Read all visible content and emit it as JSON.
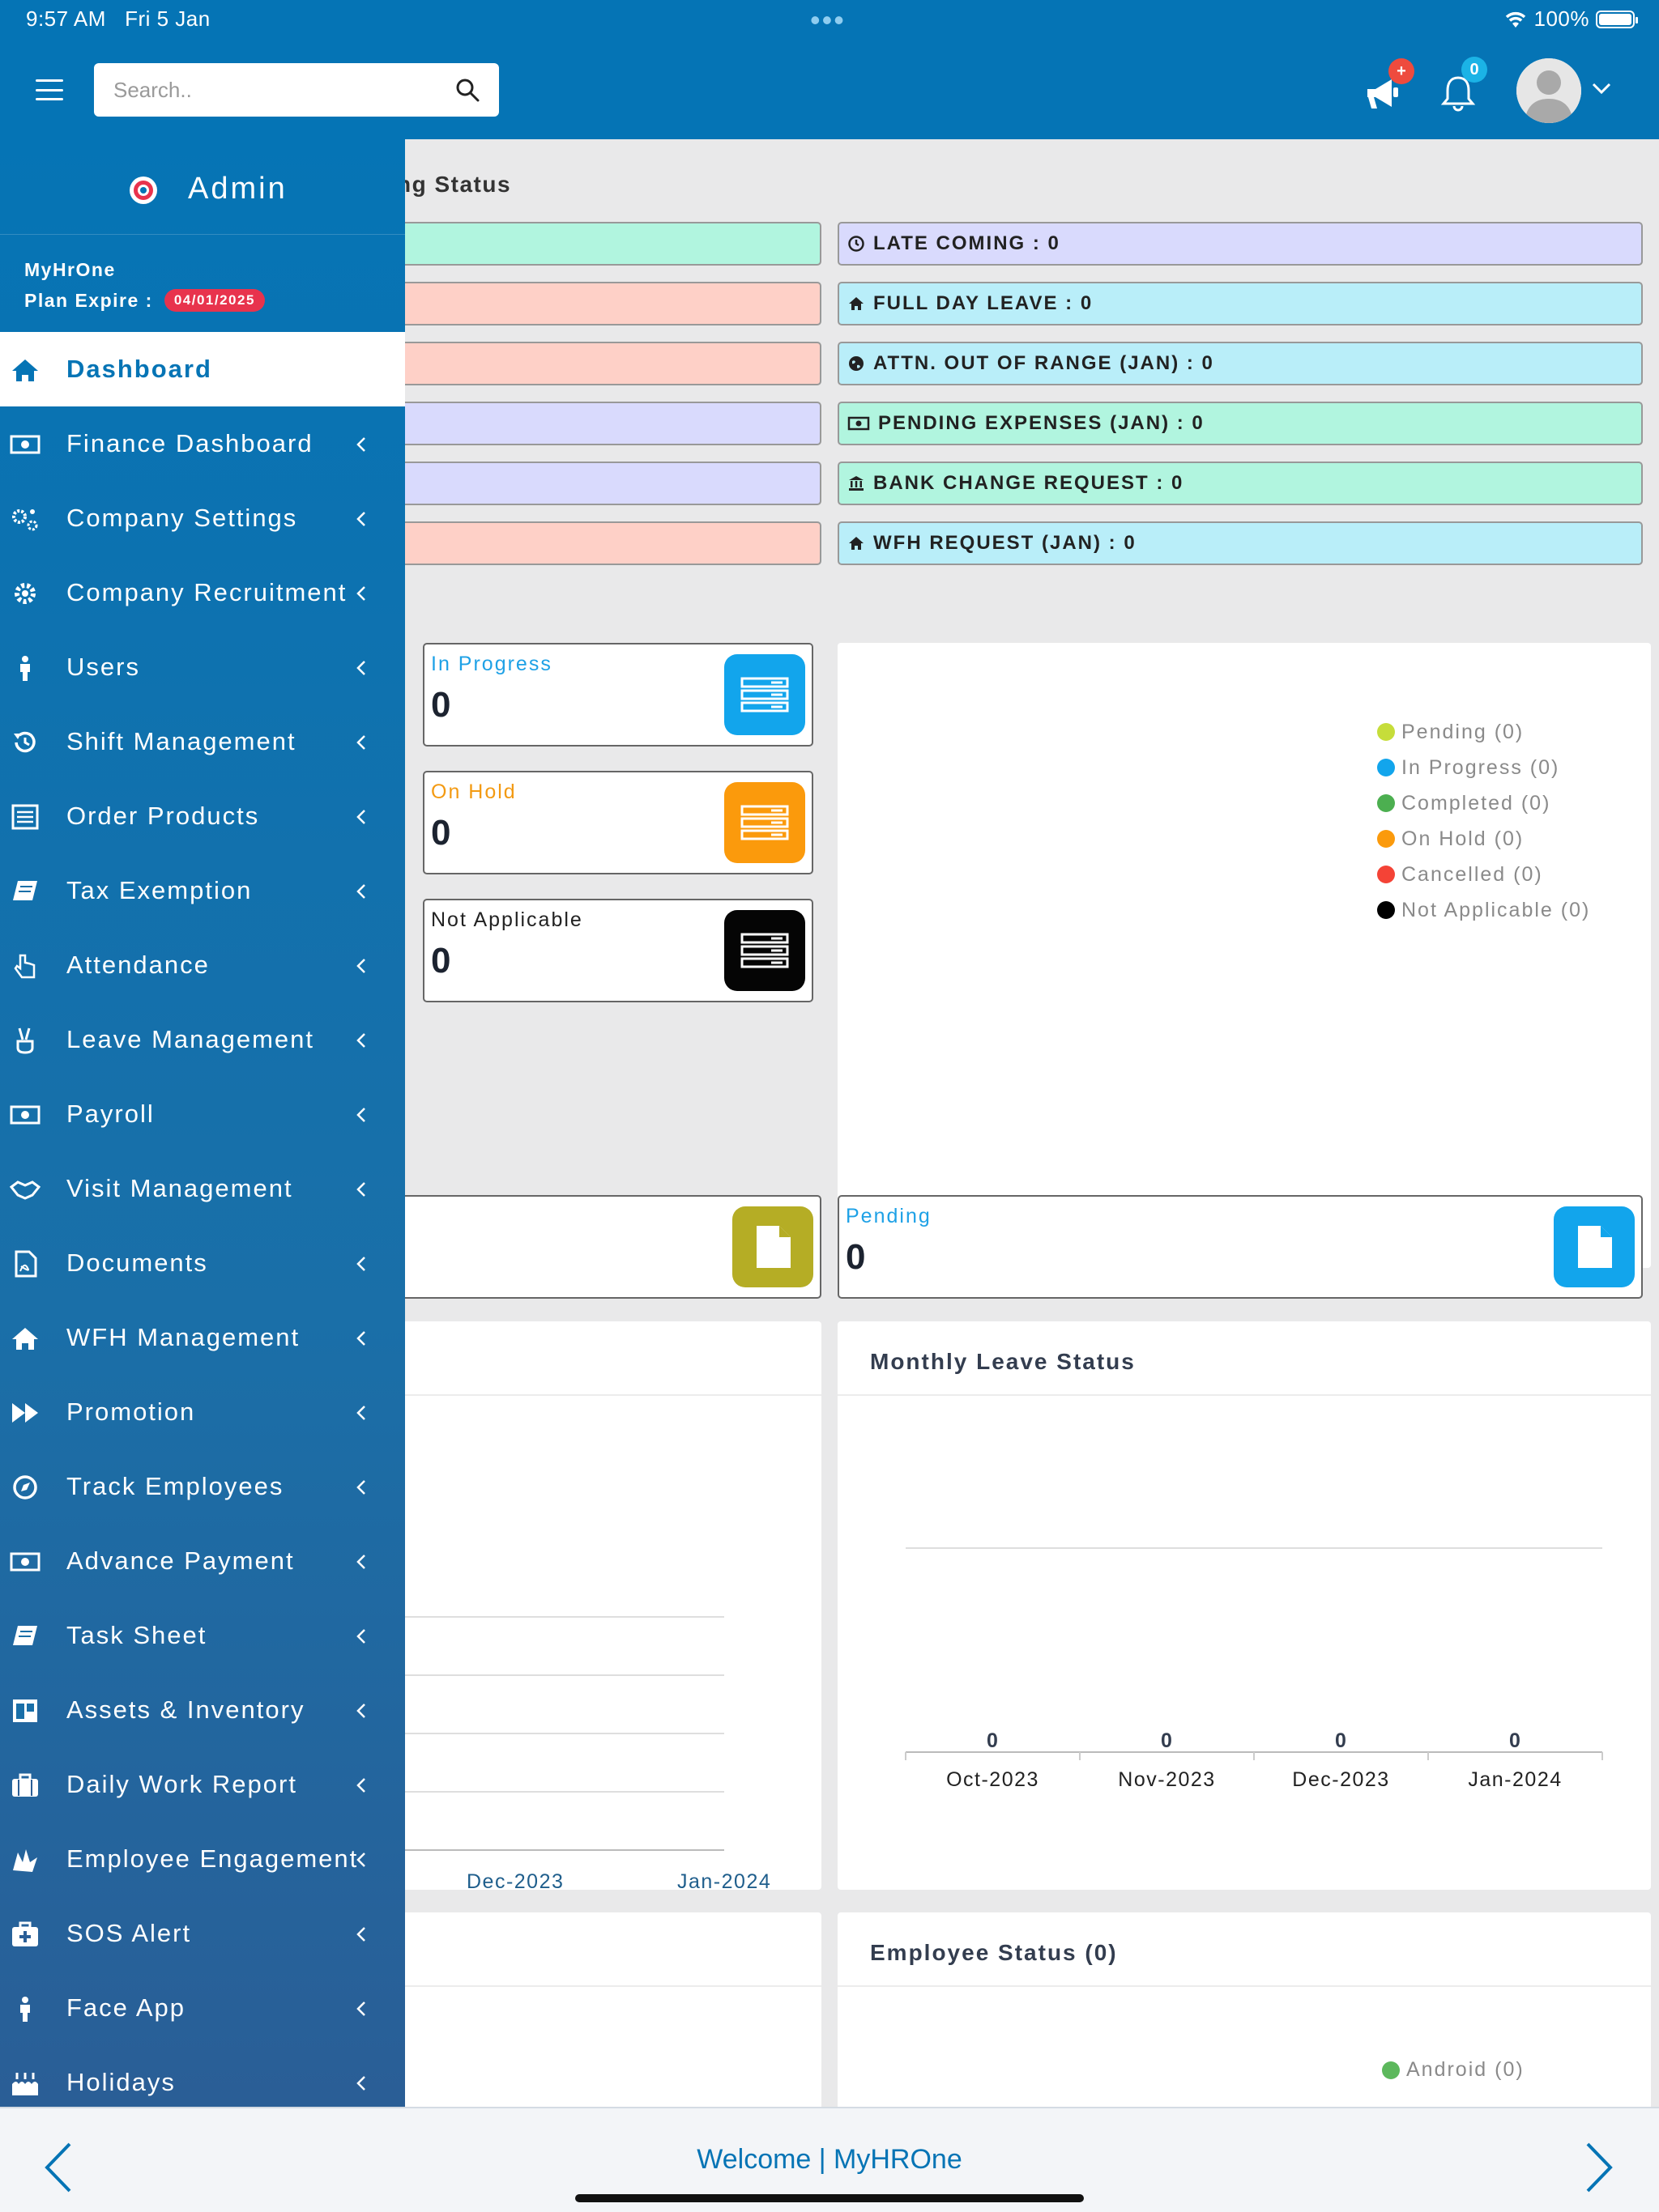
{
  "status_bar": {
    "time": "9:57 AM",
    "date": "Fri 5 Jan",
    "battery": "100%"
  },
  "header": {
    "search_placeholder": "Search..",
    "announce_badge": "+",
    "notification_count": "0"
  },
  "sidebar": {
    "title": "Admin",
    "company": "MyHrOne",
    "plan_label": "Plan Expire :",
    "plan_expire": "04/01/2025",
    "items": [
      {
        "label": "Dashboard",
        "icon": "home-icon"
      },
      {
        "label": "Finance Dashboard",
        "icon": "money-icon"
      },
      {
        "label": "Company Settings",
        "icon": "gears-icon"
      },
      {
        "label": "Company Recruitment",
        "icon": "gear-icon"
      },
      {
        "label": "Users",
        "icon": "person-icon"
      },
      {
        "label": "Shift Management",
        "icon": "history-icon"
      },
      {
        "label": "Order Products",
        "icon": "list-icon"
      },
      {
        "label": "Tax Exemption",
        "icon": "book-icon"
      },
      {
        "label": "Attendance",
        "icon": "hand-pointer-icon"
      },
      {
        "label": "Leave Management",
        "icon": "peace-hand-icon"
      },
      {
        "label": "Payroll",
        "icon": "money-icon"
      },
      {
        "label": "Visit Management",
        "icon": "handshake-icon"
      },
      {
        "label": "Documents",
        "icon": "pdf-file-icon"
      },
      {
        "label": "WFH Management",
        "icon": "home-icon"
      },
      {
        "label": "Promotion",
        "icon": "fast-forward-icon"
      },
      {
        "label": "Track Employees",
        "icon": "compass-icon"
      },
      {
        "label": "Advance Payment",
        "icon": "money-icon"
      },
      {
        "label": "Task Sheet",
        "icon": "book-icon"
      },
      {
        "label": "Assets & Inventory",
        "icon": "columns-icon"
      },
      {
        "label": "Daily Work Report",
        "icon": "briefcase-icon"
      },
      {
        "label": "Employee Engagement",
        "icon": "hands-icon"
      },
      {
        "label": "SOS Alert",
        "icon": "medkit-icon"
      },
      {
        "label": "Face App",
        "icon": "person-icon"
      },
      {
        "label": "Holidays",
        "icon": "cake-icon"
      }
    ]
  },
  "status_section": {
    "title": "ng Status",
    "right_boxes": [
      {
        "label": "LATE COMING : 0",
        "icon": "clock-icon",
        "color": "lavender"
      },
      {
        "label": "FULL DAY LEAVE : 0",
        "icon": "home-icon",
        "color": "cyan"
      },
      {
        "label": "ATTN. OUT OF RANGE (JAN) : 0",
        "icon": "globe-icon",
        "color": "cyan"
      },
      {
        "label": "PENDING EXPENSES (JAN) : 0",
        "icon": "money-icon",
        "color": "green"
      },
      {
        "label": "BANK CHANGE REQUEST : 0",
        "icon": "bank-icon",
        "color": "green"
      },
      {
        "label": "WFH REQUEST (JAN) : 0",
        "icon": "home-icon",
        "color": "cyan"
      }
    ]
  },
  "task_cards": [
    {
      "label": "In Progress",
      "value": "0",
      "color": "#1ea1e6",
      "icon_bg": "#12a5ec"
    },
    {
      "label": "On Hold",
      "value": "0",
      "color": "#f39a12",
      "icon_bg": "#fb9a0c"
    },
    {
      "label": "Not Applicable",
      "value": "0",
      "color": "#222222",
      "icon_bg": "#050505"
    }
  ],
  "task_legend": [
    {
      "label": "Pending (0)",
      "color": "#c6dd3a"
    },
    {
      "label": "In Progress (0)",
      "color": "#12a5ec"
    },
    {
      "label": "Completed (0)",
      "color": "#4caf50"
    },
    {
      "label": "On Hold (0)",
      "color": "#fb9a0c"
    },
    {
      "label": "Cancelled (0)",
      "color": "#f44336"
    },
    {
      "label": "Not Applicable (0)",
      "color": "#000000"
    }
  ],
  "doc_card": {
    "label": "Pending",
    "value": "0"
  },
  "left_chart": {
    "x_labels": [
      "Dec-2023",
      "Jan-2024"
    ]
  },
  "monthly_leave": {
    "title": "Monthly Leave Status",
    "chart_data": {
      "type": "bar",
      "categories": [
        "Oct-2023",
        "Nov-2023",
        "Dec-2023",
        "Jan-2024"
      ],
      "values": [
        0,
        0,
        0,
        0
      ],
      "title": "Monthly Leave Status"
    }
  },
  "employee_status": {
    "title": "Employee Status (0)",
    "legend": [
      {
        "label": "Android (0)",
        "color": "#5cb85c"
      }
    ]
  },
  "footer": {
    "welcome": "Welcome | MyHROne"
  }
}
